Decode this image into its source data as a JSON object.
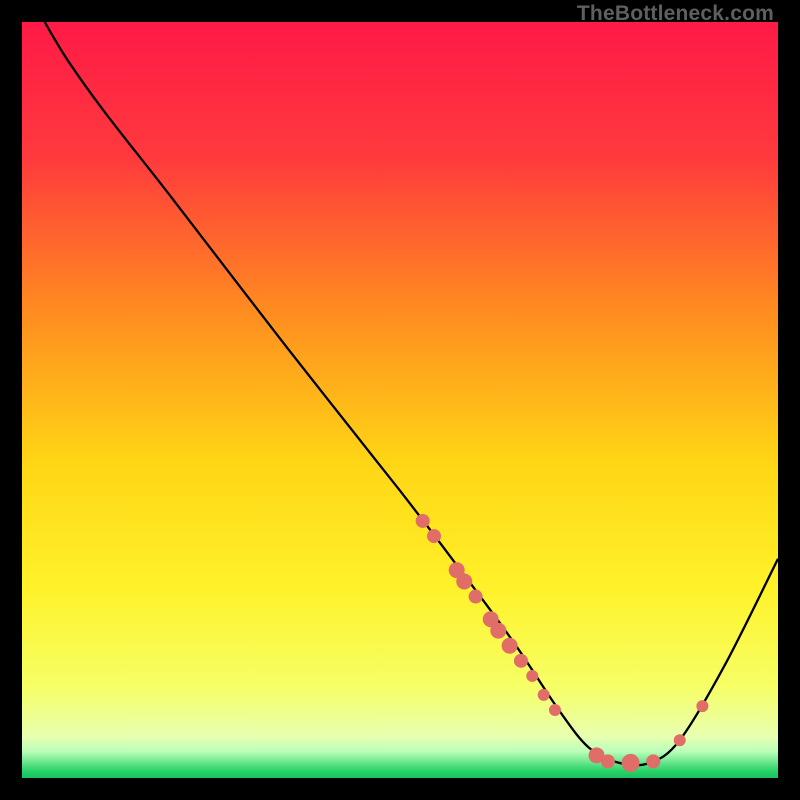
{
  "attribution": "TheBottleneck.com",
  "chart_data": {
    "type": "line",
    "title": "",
    "xlabel": "",
    "ylabel": "",
    "xlim": [
      0,
      100
    ],
    "ylim": [
      0,
      100
    ],
    "background_gradient": {
      "stops": [
        {
          "offset": 0.0,
          "color": "#ff1a47"
        },
        {
          "offset": 0.18,
          "color": "#ff3a3d"
        },
        {
          "offset": 0.38,
          "color": "#ff8b20"
        },
        {
          "offset": 0.58,
          "color": "#ffd515"
        },
        {
          "offset": 0.75,
          "color": "#fff22a"
        },
        {
          "offset": 0.88,
          "color": "#f6ff66"
        },
        {
          "offset": 0.945,
          "color": "#e8ffb0"
        },
        {
          "offset": 0.965,
          "color": "#baffba"
        },
        {
          "offset": 0.99,
          "color": "#2bd36a"
        },
        {
          "offset": 1.0,
          "color": "#18c060"
        }
      ]
    },
    "series": [
      {
        "name": "bottleneck-curve",
        "color": "#000000",
        "points": [
          {
            "x": 3.0,
            "y": 100.0
          },
          {
            "x": 6.0,
            "y": 95.0
          },
          {
            "x": 11.0,
            "y": 88.0
          },
          {
            "x": 20.0,
            "y": 76.5
          },
          {
            "x": 35.0,
            "y": 57.0
          },
          {
            "x": 50.0,
            "y": 38.0
          },
          {
            "x": 58.0,
            "y": 27.5
          },
          {
            "x": 65.0,
            "y": 18.0
          },
          {
            "x": 71.0,
            "y": 9.0
          },
          {
            "x": 75.0,
            "y": 4.0
          },
          {
            "x": 79.0,
            "y": 2.0
          },
          {
            "x": 83.0,
            "y": 2.0
          },
          {
            "x": 87.0,
            "y": 5.0
          },
          {
            "x": 93.0,
            "y": 15.0
          },
          {
            "x": 100.0,
            "y": 29.0
          }
        ]
      }
    ],
    "scatter": {
      "name": "data-points",
      "color": "#e06d67",
      "points": [
        {
          "x": 53.0,
          "y": 34.0,
          "r": 7
        },
        {
          "x": 54.5,
          "y": 32.0,
          "r": 7
        },
        {
          "x": 57.5,
          "y": 27.5,
          "r": 8
        },
        {
          "x": 58.5,
          "y": 26.0,
          "r": 8
        },
        {
          "x": 60.0,
          "y": 24.0,
          "r": 7
        },
        {
          "x": 62.0,
          "y": 21.0,
          "r": 8
        },
        {
          "x": 63.0,
          "y": 19.5,
          "r": 8
        },
        {
          "x": 64.5,
          "y": 17.5,
          "r": 8
        },
        {
          "x": 66.0,
          "y": 15.5,
          "r": 7
        },
        {
          "x": 67.5,
          "y": 13.5,
          "r": 6
        },
        {
          "x": 69.0,
          "y": 11.0,
          "r": 6
        },
        {
          "x": 70.5,
          "y": 9.0,
          "r": 6
        },
        {
          "x": 76.0,
          "y": 3.0,
          "r": 8
        },
        {
          "x": 77.5,
          "y": 2.2,
          "r": 7
        },
        {
          "x": 80.5,
          "y": 2.0,
          "r": 9
        },
        {
          "x": 83.5,
          "y": 2.2,
          "r": 7
        },
        {
          "x": 87.0,
          "y": 5.0,
          "r": 6
        },
        {
          "x": 90.0,
          "y": 9.5,
          "r": 6
        }
      ]
    }
  }
}
